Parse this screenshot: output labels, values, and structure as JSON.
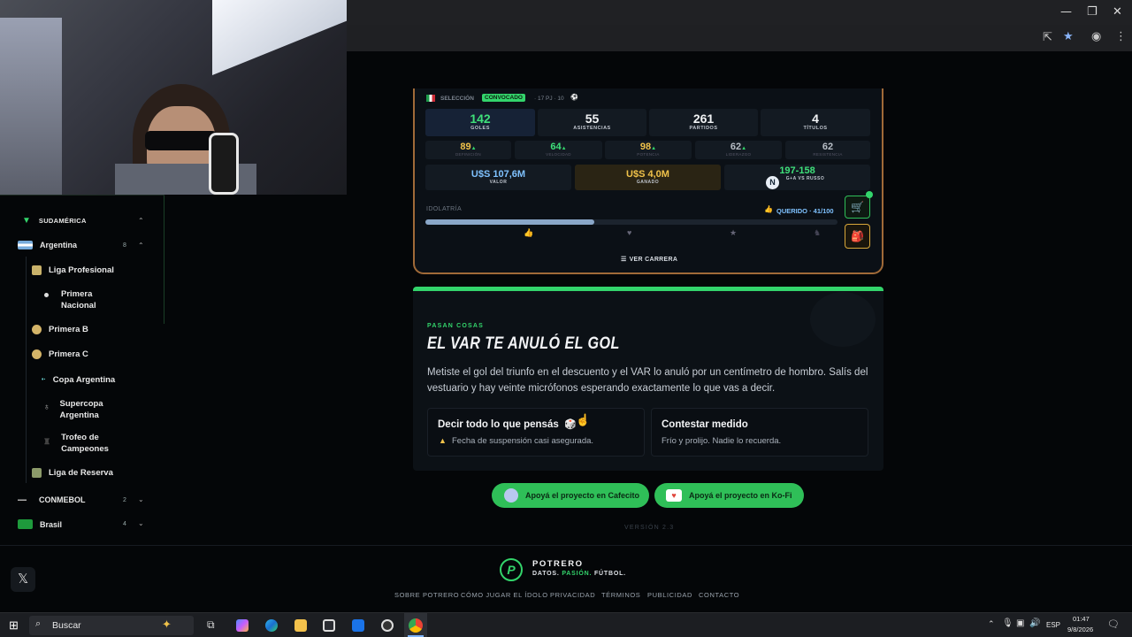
{
  "sidebar": {
    "region": {
      "label": "SUDAMÉRICA"
    },
    "country": {
      "label": "Argentina",
      "count": "8"
    },
    "leagues": [
      {
        "label": "Liga Profesional"
      },
      {
        "label": "Primera Nacional"
      },
      {
        "label": "Primera B"
      },
      {
        "label": "Primera C"
      },
      {
        "label": "Copa Argentina"
      },
      {
        "label": "Supercopa Argentina"
      },
      {
        "label": "Trofeo de Campeones"
      },
      {
        "label": "Liga de Reserva"
      }
    ],
    "conmebol": {
      "label": "CONMEBOL",
      "count": "2"
    },
    "brasil": {
      "label": "Brasil",
      "count": "4"
    }
  },
  "card": {
    "seleccion": {
      "label": "SELECCIÓN",
      "badge": "CONVOCADO",
      "meta": "· 17 PJ · 10"
    },
    "stats": [
      {
        "value": "142",
        "label": "GOLES"
      },
      {
        "value": "55",
        "label": "ASISTENCIAS"
      },
      {
        "value": "261",
        "label": "PARTIDOS"
      },
      {
        "value": "4",
        "label": "TÍTULOS"
      }
    ],
    "attrs": [
      {
        "value": "89",
        "label": "DEFINICIÓN",
        "arrow": "▲"
      },
      {
        "value": "64",
        "label": "VELOCIDAD",
        "arrow": "▲"
      },
      {
        "value": "98",
        "label": "POTENCIA",
        "arrow": "▲"
      },
      {
        "value": "62",
        "label": "LIDERAZGO",
        "arrow": "▲"
      },
      {
        "value": "62",
        "label": "RESISTENCIA",
        "arrow": ""
      }
    ],
    "valor": {
      "value": "U$S 107,6M",
      "label": "VALOR"
    },
    "ganado": {
      "value": "U$S 4,0M",
      "label": "GANADO"
    },
    "record": {
      "value": "197-158",
      "label": "G+A VS RUSSO"
    },
    "idolatria": {
      "label": "IDOLATRÍA",
      "status": "QUERIDO · 41/100",
      "progress": 0.41
    },
    "ver_carrera": "VER CARRERA"
  },
  "event": {
    "kicker": "PASAN COSAS",
    "title": "EL VAR TE ANULÓ EL GOL",
    "body": "Metiste el gol del triunfo en el descuento y el VAR lo anuló por un centímetro de hombro. Salís del vestuario y hay veinte micrófonos esperando exactamente lo que vas a decir.",
    "choices": [
      {
        "title": "Decir todo lo que pensás",
        "subtitle": "Fecha de suspensión casi asegurada."
      },
      {
        "title": "Contestar medido",
        "subtitle": "Frío y prolijo. Nadie lo recuerda."
      }
    ]
  },
  "support": {
    "cafecito": "Apoyá el proyecto en Cafecito",
    "kofi": "Apoyá el proyecto en Ko-Fi"
  },
  "version": "VERSIÓN 2.3",
  "footer": {
    "brand": "POTRERO",
    "tagline_a": "DATOS.",
    "tagline_b": "PASIÓN.",
    "tagline_c": "FÚTBOL.",
    "links": [
      "SOBRE POTRERO",
      "CÓMO JUGAR EL ÍDOLO",
      "PRIVACIDAD",
      "TÉRMINOS",
      "PUBLICIDAD",
      "CONTACTO"
    ]
  },
  "taskbar": {
    "search_placeholder": "Buscar",
    "lang": "ESP",
    "time": "01:47",
    "date": "9/8/2026"
  },
  "colors": {
    "accent": "#33d46b",
    "card_border": "#a06a38",
    "gold": "#f0c24a",
    "blue_value": "#7fc2ff"
  }
}
